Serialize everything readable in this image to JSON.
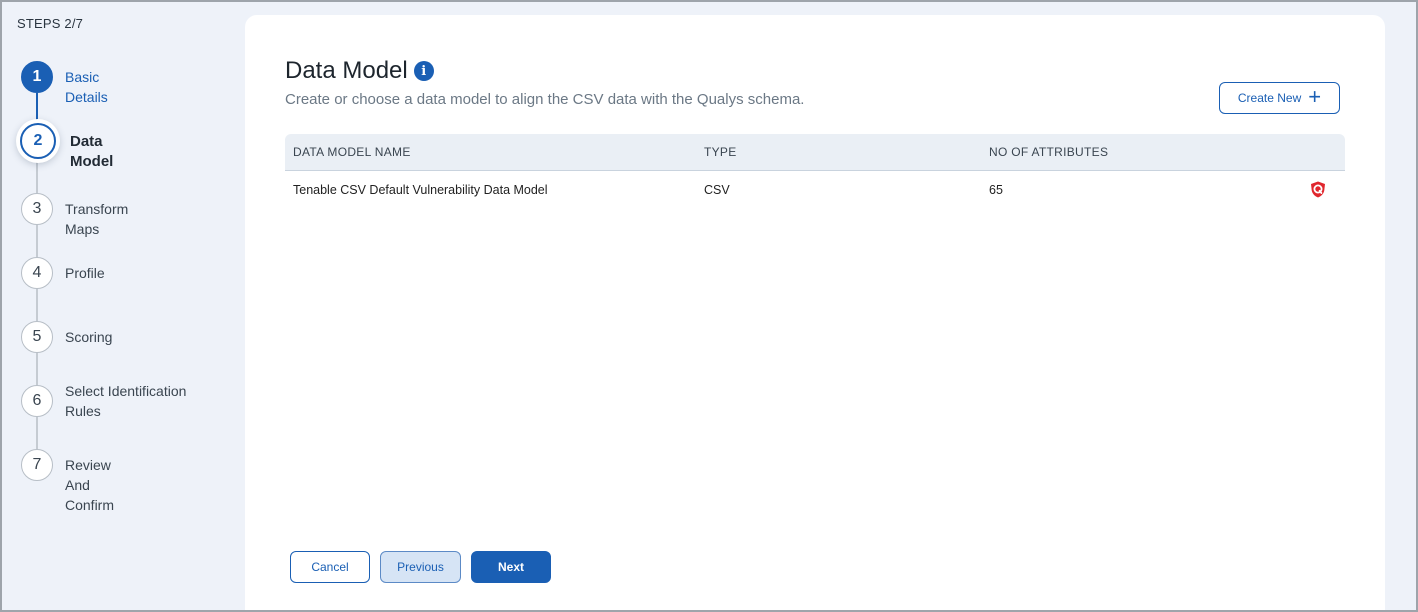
{
  "steps_header": "STEPS 2/7",
  "steps": [
    {
      "number": "1",
      "label": "Basic Details",
      "state": "completed"
    },
    {
      "number": "2",
      "label": "Data Model",
      "state": "active"
    },
    {
      "number": "3",
      "label": "Transform Maps",
      "state": "pending"
    },
    {
      "number": "4",
      "label": "Profile",
      "state": "pending"
    },
    {
      "number": "5",
      "label": "Scoring",
      "state": "pending"
    },
    {
      "number": "6",
      "label": "Select Identification Rules",
      "state": "pending"
    },
    {
      "number": "7",
      "label": "Review And Confirm",
      "state": "pending"
    }
  ],
  "main": {
    "title": "Data Model",
    "info_icon": "info-icon",
    "subtitle": "Create or choose a data model to align the CSV data with the Qualys schema.",
    "create_new_label": "Create New",
    "create_new_icon": "plus-icon"
  },
  "table": {
    "headers": [
      "DATA MODEL NAME",
      "TYPE",
      "NO OF ATTRIBUTES"
    ],
    "rows": [
      {
        "name": "Tenable CSV Default Vulnerability Data Model",
        "type": "CSV",
        "attributes": "65",
        "icon": "qualys-shield-icon"
      }
    ]
  },
  "footer": {
    "cancel_label": "Cancel",
    "previous_label": "Previous",
    "next_label": "Next"
  },
  "colors": {
    "accent": "#1a5fb4",
    "sidebar_bg": "#eef2f9",
    "qualys_red": "#e0262d"
  }
}
